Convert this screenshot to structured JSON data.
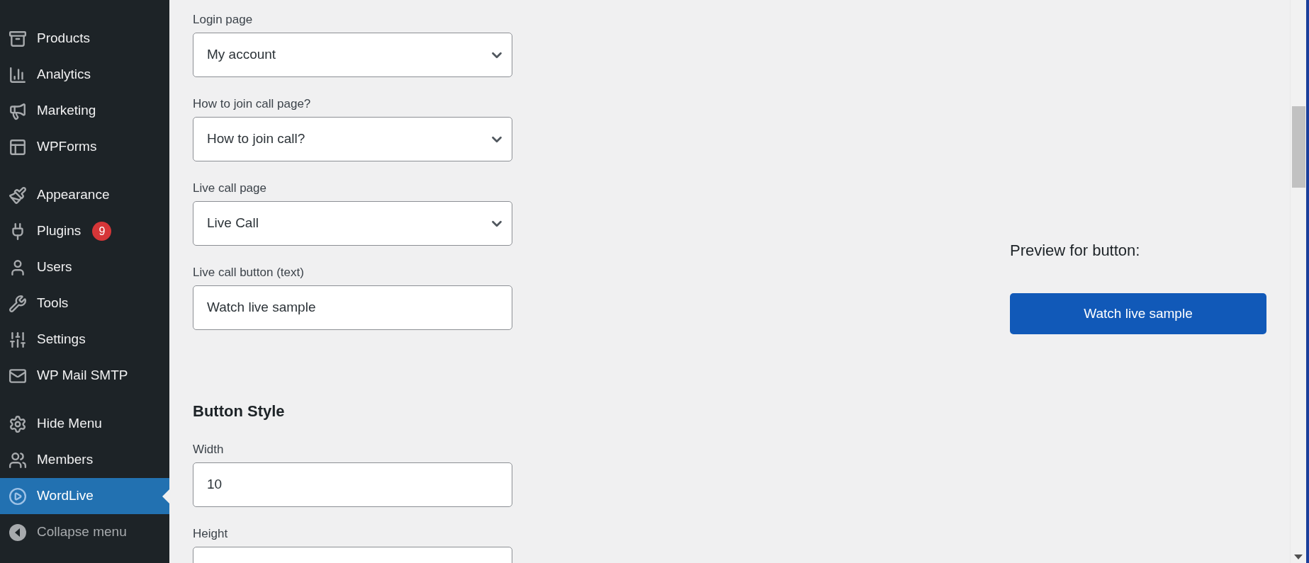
{
  "sidebar": {
    "groups": [
      {
        "items": [
          {
            "label": "Products",
            "selected": false
          },
          {
            "label": "Analytics",
            "selected": false
          },
          {
            "label": "Marketing",
            "selected": false
          },
          {
            "label": "WPForms",
            "selected": false
          }
        ]
      },
      {
        "items": [
          {
            "label": "Appearance",
            "selected": false
          },
          {
            "label": "Plugins",
            "selected": false,
            "badge": "9"
          },
          {
            "label": "Users",
            "selected": false
          },
          {
            "label": "Tools",
            "selected": false
          },
          {
            "label": "Settings",
            "selected": false
          },
          {
            "label": "WP Mail SMTP",
            "selected": false
          }
        ]
      },
      {
        "items": [
          {
            "label": "Hide Menu",
            "selected": false
          },
          {
            "label": "Members",
            "selected": false
          },
          {
            "label": "WordLive",
            "selected": true
          }
        ]
      }
    ],
    "collapse": "Collapse menu"
  },
  "form": {
    "fields": [
      {
        "label": "Login page",
        "kind": "select",
        "value": "My account"
      },
      {
        "label": "How to join call page?",
        "kind": "select",
        "value": "How to join call?"
      },
      {
        "label": "Live call page",
        "kind": "select",
        "value": "Live Call"
      },
      {
        "label": "Live call button (text)",
        "kind": "text",
        "value": "Watch live sample"
      }
    ],
    "section_title": "Button Style",
    "style_fields": [
      {
        "label": "Width",
        "kind": "text",
        "value": "10"
      },
      {
        "label": "Height",
        "kind": "text"
      }
    ]
  },
  "preview": {
    "title": "Preview for button:",
    "button": "Watch live sample"
  }
}
